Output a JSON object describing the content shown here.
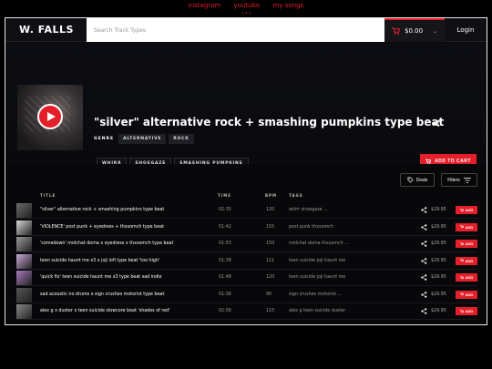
{
  "top_links": [
    "instagram",
    "youtube",
    "my songs"
  ],
  "nav": {
    "logo": "W. FALLS",
    "search_placeholder": "Search Track Types",
    "cart_total": "$0.00",
    "login": "Login"
  },
  "hero": {
    "title": "\"silver\" alternative rock + smashing pumpkins type beat",
    "genre_label": "GENRE",
    "genres": [
      "ALTERNATIVE",
      "ROCK"
    ],
    "tags": [
      "WHIRR",
      "SHOEGAZE",
      "SMASHING PUMPKINS"
    ],
    "add_to_cart": "ADD TO CART"
  },
  "tracks_toolbar": {
    "deals": "Deals",
    "filters": "Filters"
  },
  "table": {
    "headers": [
      "TITLE",
      "TIME",
      "BPM",
      "TAGS"
    ],
    "rows": [
      {
        "title": "\"silver\" alternative rock + smashing pumpkins type beat",
        "time": "02:35",
        "bpm": "120",
        "tags": "whirr shoegaze ...",
        "price": "$29.95",
        "add": "ADD"
      },
      {
        "title": "'VIOLENCE' post punk + eyedress + thxsomch type beat",
        "time": "01:42",
        "bpm": "155",
        "tags": "post punk thxsomch",
        "price": "$29.95",
        "add": "ADD"
      },
      {
        "title": "'comedown' molchat doma x eyedress x thxsomch type beat",
        "time": "01:53",
        "bpm": "150",
        "tags": "molchat doma thxsomch ...",
        "price": "$29.95",
        "add": "ADD"
      },
      {
        "title": "teen suicide haunt me x3 x joji lofi type beat 'too high'",
        "time": "01:39",
        "bpm": "111",
        "tags": "teen suicide joji haunt me",
        "price": "$29.95",
        "add": "ADD"
      },
      {
        "title": "'quick fix' teen suicide haunt me x3 type beat sad indie",
        "time": "01:48",
        "tags": "teen suicide joji haunt me",
        "bpm": "120",
        "price": "$29.95",
        "add": "ADD"
      },
      {
        "title": "sad acoustic no drums x sign crushes motorist type beat",
        "time": "01:36",
        "bpm": "90",
        "tags": "sign crushes motorist ...",
        "price": "$29.95",
        "add": "ADD"
      },
      {
        "title": "alex g x duster x teen suicide slowcore beat 'shades of red'",
        "time": "02:56",
        "bpm": "115",
        "tags": "alex g teen suicide duster",
        "price": "$29.95",
        "add": "ADD"
      }
    ]
  },
  "colors": {
    "accent": "#e3202a",
    "background": "#0a0a0c"
  }
}
